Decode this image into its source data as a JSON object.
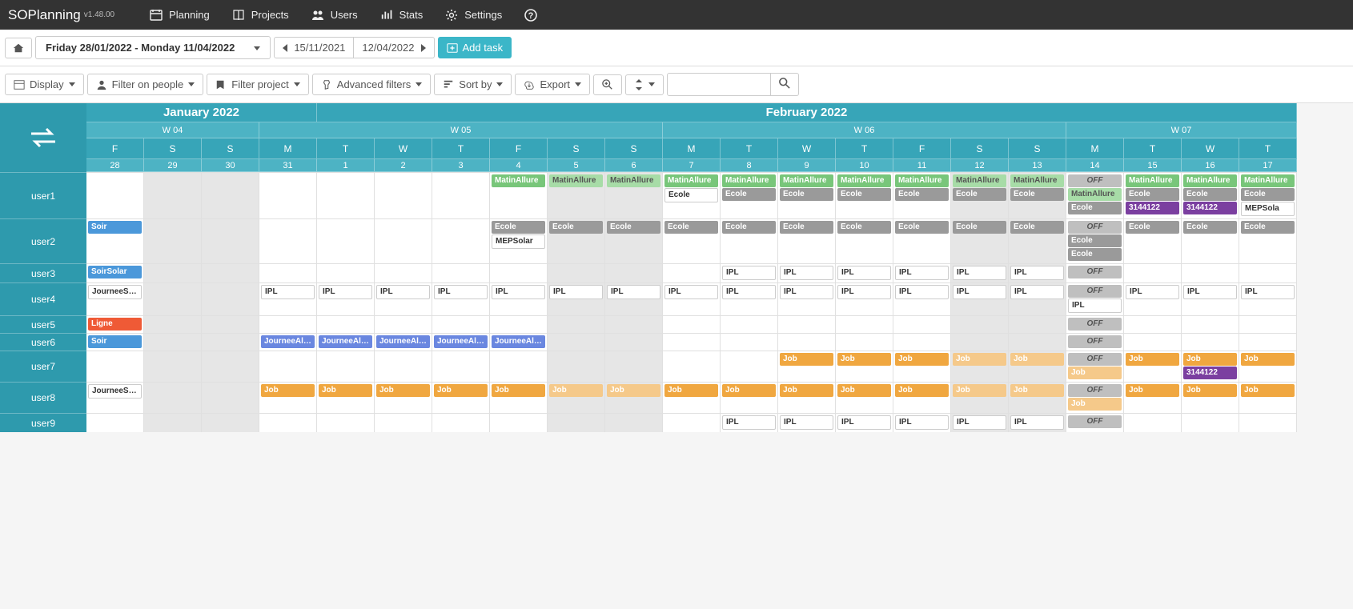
{
  "brand": "SOPlanning",
  "version": "v1.48.00",
  "nav": [
    {
      "label": "Planning",
      "icon": "calendar"
    },
    {
      "label": "Projects",
      "icon": "book"
    },
    {
      "label": "Users",
      "icon": "users"
    },
    {
      "label": "Stats",
      "icon": "bars"
    },
    {
      "label": "Settings",
      "icon": "gear"
    }
  ],
  "toolbar1": {
    "dateRange": "Friday 28/01/2022 - Monday 11/04/2022",
    "prev": "15/11/2021",
    "next": "12/04/2022",
    "addTask": "Add task"
  },
  "toolbar2": {
    "display": "Display",
    "filterPeople": "Filter on people",
    "filterProject": "Filter project",
    "advanced": "Advanced filters",
    "sort": "Sort by",
    "export": "Export"
  },
  "months": [
    "January 2022",
    "February 2022"
  ],
  "weeks": [
    "W 04",
    "W 05",
    "W 06",
    "W 07"
  ],
  "days": [
    {
      "d": "F",
      "n": "28",
      "wk": false
    },
    {
      "d": "S",
      "n": "29",
      "wk": true
    },
    {
      "d": "S",
      "n": "30",
      "wk": true
    },
    {
      "d": "M",
      "n": "31",
      "wk": false
    },
    {
      "d": "T",
      "n": "1",
      "wk": false
    },
    {
      "d": "W",
      "n": "2",
      "wk": false
    },
    {
      "d": "T",
      "n": "3",
      "wk": false
    },
    {
      "d": "F",
      "n": "4",
      "wk": false
    },
    {
      "d": "S",
      "n": "5",
      "wk": true
    },
    {
      "d": "S",
      "n": "6",
      "wk": true
    },
    {
      "d": "M",
      "n": "7",
      "wk": false
    },
    {
      "d": "T",
      "n": "8",
      "wk": false
    },
    {
      "d": "W",
      "n": "9",
      "wk": false
    },
    {
      "d": "T",
      "n": "10",
      "wk": false
    },
    {
      "d": "F",
      "n": "11",
      "wk": false
    },
    {
      "d": "S",
      "n": "12",
      "wk": true
    },
    {
      "d": "S",
      "n": "13",
      "wk": true
    },
    {
      "d": "M",
      "n": "14",
      "wk": false
    },
    {
      "d": "T",
      "n": "15",
      "wk": false
    },
    {
      "d": "W",
      "n": "16",
      "wk": false
    },
    {
      "d": "T",
      "n": "17",
      "wk": false
    }
  ],
  "users": [
    "user1",
    "user2",
    "user3",
    "user4",
    "user5",
    "user6",
    "user7",
    "user8",
    "user9"
  ],
  "tasks": {
    "user1": {
      "7": [
        {
          "t": "MatinAllure",
          "c": "green"
        }
      ],
      "8": [
        {
          "t": "MatinAllure",
          "c": "green2"
        }
      ],
      "9": [
        {
          "t": "MatinAllure",
          "c": "green2"
        }
      ],
      "10": [
        {
          "t": "MatinAllure",
          "c": "green"
        },
        {
          "t": "Ecole",
          "c": "white"
        }
      ],
      "11": [
        {
          "t": "MatinAllure",
          "c": "green"
        },
        {
          "t": "Ecole",
          "c": "grey"
        }
      ],
      "12": [
        {
          "t": "MatinAllure",
          "c": "green"
        },
        {
          "t": "Ecole",
          "c": "grey"
        }
      ],
      "13": [
        {
          "t": "MatinAllure",
          "c": "green"
        },
        {
          "t": "Ecole",
          "c": "grey"
        }
      ],
      "14": [
        {
          "t": "MatinAllure",
          "c": "green"
        },
        {
          "t": "Ecole",
          "c": "grey"
        }
      ],
      "15": [
        {
          "t": "MatinAllure",
          "c": "green2"
        },
        {
          "t": "Ecole",
          "c": "grey"
        }
      ],
      "16": [
        {
          "t": "MatinAllure",
          "c": "green2"
        },
        {
          "t": "Ecole",
          "c": "grey"
        }
      ],
      "17": [
        {
          "t": "OFF",
          "c": "off"
        },
        {
          "t": "MatinAllure",
          "c": "green2"
        },
        {
          "t": "Ecole",
          "c": "grey"
        }
      ],
      "18": [
        {
          "t": "MatinAllure",
          "c": "green"
        },
        {
          "t": "Ecole",
          "c": "grey"
        },
        {
          "t": "3144122",
          "c": "purple"
        }
      ],
      "19": [
        {
          "t": "MatinAllure",
          "c": "green"
        },
        {
          "t": "Ecole",
          "c": "grey"
        },
        {
          "t": "3144122",
          "c": "purple"
        }
      ],
      "20": [
        {
          "t": "MatinAllure",
          "c": "green"
        },
        {
          "t": "Ecole",
          "c": "grey"
        },
        {
          "t": "MEPSola",
          "c": "white"
        }
      ]
    },
    "user2": {
      "0": [
        {
          "t": "Soir",
          "c": "lblue"
        }
      ],
      "7": [
        {
          "t": "Ecole",
          "c": "grey"
        },
        {
          "t": "MEPSolar",
          "c": "white"
        }
      ],
      "8": [
        {
          "t": "Ecole",
          "c": "grey"
        }
      ],
      "9": [
        {
          "t": "Ecole",
          "c": "grey"
        }
      ],
      "10": [
        {
          "t": "Ecole",
          "c": "grey"
        }
      ],
      "11": [
        {
          "t": "Ecole",
          "c": "grey"
        }
      ],
      "12": [
        {
          "t": "Ecole",
          "c": "grey"
        }
      ],
      "13": [
        {
          "t": "Ecole",
          "c": "grey"
        }
      ],
      "14": [
        {
          "t": "Ecole",
          "c": "grey"
        }
      ],
      "15": [
        {
          "t": "Ecole",
          "c": "grey"
        }
      ],
      "16": [
        {
          "t": "Ecole",
          "c": "grey"
        }
      ],
      "17": [
        {
          "t": "OFF",
          "c": "off"
        },
        {
          "t": "Ecole",
          "c": "grey"
        },
        {
          "t": "Ecole",
          "c": "grey"
        }
      ],
      "18": [
        {
          "t": "Ecole",
          "c": "grey"
        }
      ],
      "19": [
        {
          "t": "Ecole",
          "c": "grey"
        }
      ],
      "20": [
        {
          "t": "Ecole",
          "c": "grey"
        }
      ]
    },
    "user3": {
      "0": [
        {
          "t": "SoirSolar",
          "c": "lblue"
        }
      ],
      "11": [
        {
          "t": "IPL",
          "c": "ipl"
        }
      ],
      "12": [
        {
          "t": "IPL",
          "c": "ipl"
        }
      ],
      "13": [
        {
          "t": "IPL",
          "c": "ipl"
        }
      ],
      "14": [
        {
          "t": "IPL",
          "c": "ipl"
        }
      ],
      "15": [
        {
          "t": "IPL",
          "c": "ipl"
        }
      ],
      "16": [
        {
          "t": "IPL",
          "c": "ipl"
        }
      ],
      "17": [
        {
          "t": "OFF",
          "c": "off"
        }
      ]
    },
    "user4": {
      "0": [
        {
          "t": "JourneeSolar",
          "c": "white"
        }
      ],
      "3": [
        {
          "t": "IPL",
          "c": "ipl"
        }
      ],
      "4": [
        {
          "t": "IPL",
          "c": "ipl"
        }
      ],
      "5": [
        {
          "t": "IPL",
          "c": "ipl"
        }
      ],
      "6": [
        {
          "t": "IPL",
          "c": "ipl"
        }
      ],
      "7": [
        {
          "t": "IPL",
          "c": "ipl"
        }
      ],
      "8": [
        {
          "t": "IPL",
          "c": "ipl"
        }
      ],
      "9": [
        {
          "t": "IPL",
          "c": "ipl"
        }
      ],
      "10": [
        {
          "t": "IPL",
          "c": "ipl"
        }
      ],
      "11": [
        {
          "t": "IPL",
          "c": "ipl"
        }
      ],
      "12": [
        {
          "t": "IPL",
          "c": "ipl"
        }
      ],
      "13": [
        {
          "t": "IPL",
          "c": "ipl"
        }
      ],
      "14": [
        {
          "t": "IPL",
          "c": "ipl"
        }
      ],
      "15": [
        {
          "t": "IPL",
          "c": "ipl"
        }
      ],
      "16": [
        {
          "t": "IPL",
          "c": "ipl"
        }
      ],
      "17": [
        {
          "t": "OFF",
          "c": "off"
        },
        {
          "t": "IPL",
          "c": "ipl"
        }
      ],
      "18": [
        {
          "t": "IPL",
          "c": "ipl"
        }
      ],
      "19": [
        {
          "t": "IPL",
          "c": "ipl"
        }
      ],
      "20": [
        {
          "t": "IPL",
          "c": "ipl"
        }
      ]
    },
    "user5": {
      "0": [
        {
          "t": "Ligne",
          "c": "red"
        }
      ],
      "17": [
        {
          "t": "OFF",
          "c": "off"
        }
      ]
    },
    "user6": {
      "0": [
        {
          "t": "Soir",
          "c": "lblue"
        }
      ],
      "3": [
        {
          "t": "JourneeAllur",
          "c": "blue"
        }
      ],
      "4": [
        {
          "t": "JourneeAllur",
          "c": "blue"
        }
      ],
      "5": [
        {
          "t": "JourneeAllur",
          "c": "blue"
        }
      ],
      "6": [
        {
          "t": "JourneeAllur",
          "c": "blue"
        }
      ],
      "7": [
        {
          "t": "JourneeAllur",
          "c": "blue"
        }
      ],
      "17": [
        {
          "t": "OFF",
          "c": "off"
        }
      ]
    },
    "user7": {
      "12": [
        {
          "t": "Job",
          "c": "orange"
        }
      ],
      "13": [
        {
          "t": "Job",
          "c": "orange"
        }
      ],
      "14": [
        {
          "t": "Job",
          "c": "orange"
        }
      ],
      "15": [
        {
          "t": "Job",
          "c": "orange2"
        }
      ],
      "16": [
        {
          "t": "Job",
          "c": "orange2"
        }
      ],
      "17": [
        {
          "t": "OFF",
          "c": "off"
        },
        {
          "t": "Job",
          "c": "orange2"
        }
      ],
      "18": [
        {
          "t": "Job",
          "c": "orange"
        }
      ],
      "19": [
        {
          "t": "Job",
          "c": "orange"
        },
        {
          "t": "3144122",
          "c": "purple"
        }
      ],
      "20": [
        {
          "t": "Job",
          "c": "orange"
        }
      ]
    },
    "user8": {
      "0": [
        {
          "t": "JourneeSolar",
          "c": "white"
        }
      ],
      "3": [
        {
          "t": "Job",
          "c": "orange"
        }
      ],
      "4": [
        {
          "t": "Job",
          "c": "orange"
        }
      ],
      "5": [
        {
          "t": "Job",
          "c": "orange"
        }
      ],
      "6": [
        {
          "t": "Job",
          "c": "orange"
        }
      ],
      "7": [
        {
          "t": "Job",
          "c": "orange"
        }
      ],
      "8": [
        {
          "t": "Job",
          "c": "orange2"
        }
      ],
      "9": [
        {
          "t": "Job",
          "c": "orange2"
        }
      ],
      "10": [
        {
          "t": "Job",
          "c": "orange"
        }
      ],
      "11": [
        {
          "t": "Job",
          "c": "orange"
        }
      ],
      "12": [
        {
          "t": "Job",
          "c": "orange"
        }
      ],
      "13": [
        {
          "t": "Job",
          "c": "orange"
        }
      ],
      "14": [
        {
          "t": "Job",
          "c": "orange"
        }
      ],
      "15": [
        {
          "t": "Job",
          "c": "orange2"
        }
      ],
      "16": [
        {
          "t": "Job",
          "c": "orange2"
        }
      ],
      "17": [
        {
          "t": "OFF",
          "c": "off"
        },
        {
          "t": "Job",
          "c": "orange2"
        }
      ],
      "18": [
        {
          "t": "Job",
          "c": "orange"
        }
      ],
      "19": [
        {
          "t": "Job",
          "c": "orange"
        }
      ],
      "20": [
        {
          "t": "Job",
          "c": "orange"
        }
      ]
    },
    "user9": {
      "11": [
        {
          "t": "IPL",
          "c": "ipl"
        }
      ],
      "12": [
        {
          "t": "IPL",
          "c": "ipl"
        }
      ],
      "13": [
        {
          "t": "IPL",
          "c": "ipl"
        }
      ],
      "14": [
        {
          "t": "IPL",
          "c": "ipl"
        }
      ],
      "15": [
        {
          "t": "IPL",
          "c": "ipl"
        }
      ],
      "16": [
        {
          "t": "IPL",
          "c": "ipl"
        }
      ],
      "17": [
        {
          "t": "OFF",
          "c": "off"
        }
      ]
    }
  }
}
